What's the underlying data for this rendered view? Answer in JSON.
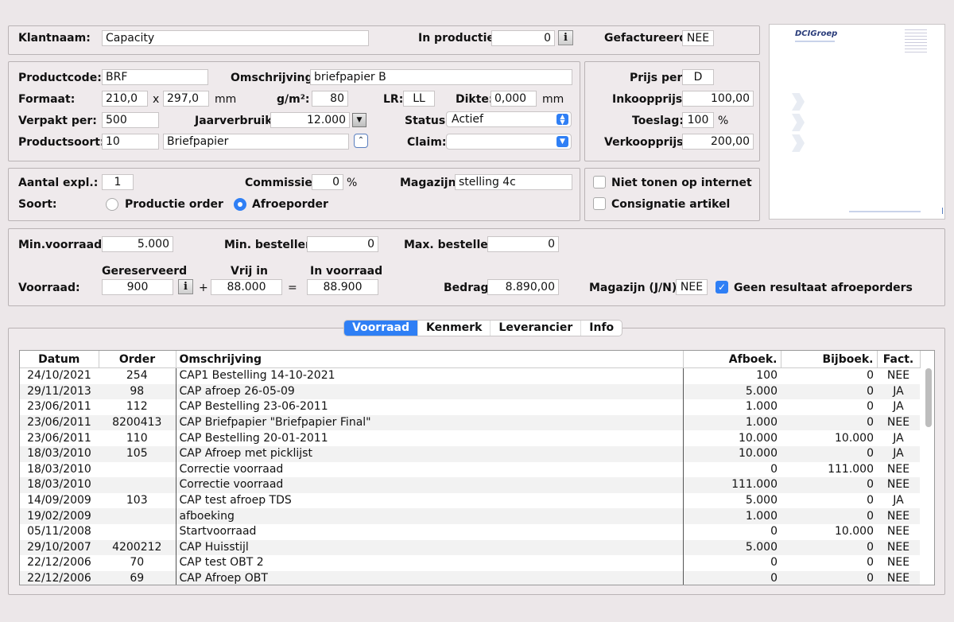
{
  "customer": {
    "label": "Klantnaam:",
    "value": "Capacity"
  },
  "production": {
    "label": "In productie:",
    "value": "0",
    "info": "i"
  },
  "invoiced": {
    "label": "Gefactureerd:",
    "value": "NEE"
  },
  "product": {
    "code_label": "Productcode:",
    "code": "BRF",
    "desc_label": "Omschrijving:",
    "desc": "briefpapier B",
    "format_label": "Formaat:",
    "width": "210,0",
    "x": "x",
    "height": "297,0",
    "mm": "mm",
    "gsm_label": "g/m²:",
    "gsm": "80",
    "lr_label": "LR:",
    "lr": "LL",
    "thickness_label": "Dikte:",
    "thickness": "0,000",
    "mm2": "mm",
    "packed_label": "Verpakt per:",
    "packed": "500",
    "annual_label": "Jaarverbruik:",
    "annual": "12.000",
    "status_label": "Status:",
    "status": "Actief",
    "type_label": "Productsoort:",
    "type_code": "10",
    "type_name": "Briefpapier",
    "claim_label": "Claim:",
    "claim": ""
  },
  "pricing": {
    "per_label": "Prijs per:",
    "per": "D",
    "purchase_label": "Inkoopprijs:",
    "purchase": "100,00",
    "surcharge_label": "Toeslag:",
    "surcharge": "100",
    "pct": "%",
    "sale_label": "Verkoopprijs:",
    "sale": "200,00"
  },
  "copies": {
    "count_label": "Aantal expl.:",
    "count": "1",
    "commission_label": "Commissie:",
    "commission": "0",
    "pct": "%",
    "warehouse_label": "Magazijn:",
    "warehouse": "stelling 4c",
    "kind_label": "Soort:",
    "opt_production": "Productie order",
    "opt_call": "Afroeporder"
  },
  "flags": {
    "internet": "Niet tonen op internet",
    "consignment": "Consignatie artikel"
  },
  "preview": {
    "brand": "DCIGroep"
  },
  "stock": {
    "min_label": "Min.voorraad:",
    "min": "5.000",
    "min_order_label": "Min. bestellen:",
    "min_order": "0",
    "max_order_label": "Max. bestellen:",
    "max_order": "0",
    "reserved_label": "Gereserveerd",
    "free_label": "Vrij in",
    "instock_label": "In voorraad",
    "stock_label": "Voorraad:",
    "reserved": "900",
    "plus": "+",
    "free": "88.000",
    "eq": "=",
    "instock": "88.900",
    "amount_label": "Bedrag:",
    "amount": "8.890,00",
    "wh_yn_label": "Magazijn (J/N):",
    "wh_yn": "NEE",
    "no_result": "Geen resultaat afroeporders"
  },
  "tabs": [
    "Voorraad",
    "Kenmerk",
    "Leverancier",
    "Info"
  ],
  "table": {
    "headers": [
      "Datum",
      "Order",
      "Omschrijving",
      "Afboek.",
      "Bijboek.",
      "Fact."
    ],
    "rows": [
      [
        "24/10/2021",
        "254",
        "CAP1 Bestelling 14-10-2021",
        "100",
        "0",
        "NEE"
      ],
      [
        "29/11/2013",
        "98",
        "CAP afroep 26-05-09",
        "5.000",
        "0",
        "JA"
      ],
      [
        "23/06/2011",
        "112",
        "CAP Bestelling 23-06-2011",
        "1.000",
        "0",
        "JA"
      ],
      [
        "23/06/2011",
        "8200413",
        "CAP Briefpapier \"Briefpapier Final\"",
        "1.000",
        "0",
        "NEE"
      ],
      [
        "23/06/2011",
        "110",
        "CAP Bestelling 20-01-2011",
        "10.000",
        "10.000",
        "JA"
      ],
      [
        "18/03/2010",
        "105",
        "CAP Afroep met picklijst",
        "10.000",
        "0",
        "JA"
      ],
      [
        "18/03/2010",
        "",
        "Correctie voorraad",
        "0",
        "111.000",
        "NEE"
      ],
      [
        "18/03/2010",
        "",
        "Correctie voorraad",
        "111.000",
        "0",
        "NEE"
      ],
      [
        "14/09/2009",
        "103",
        "CAP test afroep TDS",
        "5.000",
        "0",
        "JA"
      ],
      [
        "19/02/2009",
        "",
        "afboeking",
        "1.000",
        "0",
        "NEE"
      ],
      [
        "05/11/2008",
        "",
        "Startvoorraad",
        "0",
        "10.000",
        "NEE"
      ],
      [
        "29/10/2007",
        "4200212",
        "CAP Huisstijl",
        "5.000",
        "0",
        "NEE"
      ],
      [
        "22/12/2006",
        "70",
        "CAP test OBT 2",
        "0",
        "0",
        "NEE"
      ],
      [
        "22/12/2006",
        "69",
        "CAP Afroep OBT",
        "0",
        "0",
        "NEE"
      ]
    ]
  }
}
